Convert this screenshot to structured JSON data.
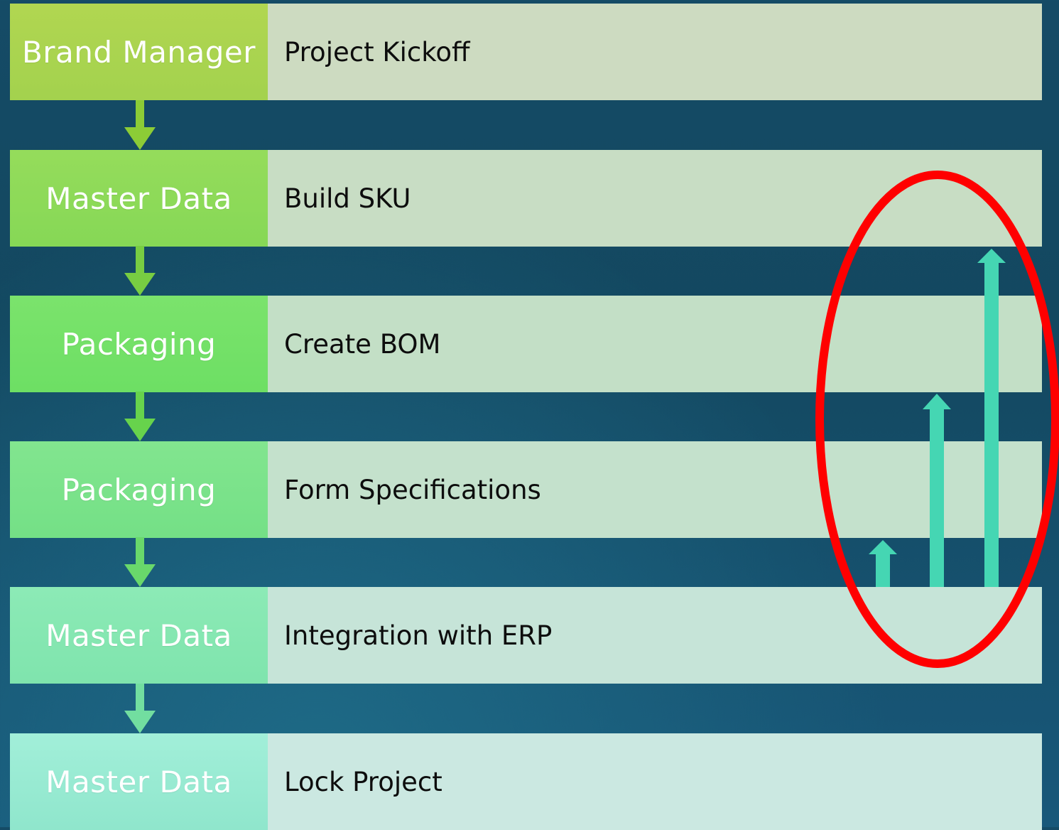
{
  "steps": [
    {
      "role": "Brand Manager",
      "task": "Project Kickoff"
    },
    {
      "role": "Master Data",
      "task": "Build SKU"
    },
    {
      "role": "Packaging",
      "task": "Create BOM"
    },
    {
      "role": "Packaging",
      "task": "Form Specifications"
    },
    {
      "role": "Master Data",
      "task": "Integration with ERP"
    },
    {
      "role": "Master Data",
      "task": "Lock Project"
    }
  ],
  "colors": {
    "role_gradients": [
      [
        "#b1d651",
        "#a3d24e"
      ],
      [
        "#95dc5b",
        "#86d856"
      ],
      [
        "#7be36c",
        "#6ddf64"
      ],
      [
        "#82e58f",
        "#74e086"
      ],
      [
        "#8ceab6",
        "#7fe4ad"
      ],
      [
        "#a2efd9",
        "#8fe6cc"
      ]
    ],
    "task_backgrounds": [
      "#cddbc1",
      "#c8ddc4",
      "#c3dfc6",
      "#c4e1cc",
      "#c6e4d8",
      "#cbe8e1"
    ],
    "connector_arrows": [
      "#8ccc36",
      "#78cd42",
      "#67d34c",
      "#69d86b",
      "#72dea0"
    ],
    "highlight_ellipse": "#ff0000",
    "growth_arrows": "#45d6b3"
  }
}
